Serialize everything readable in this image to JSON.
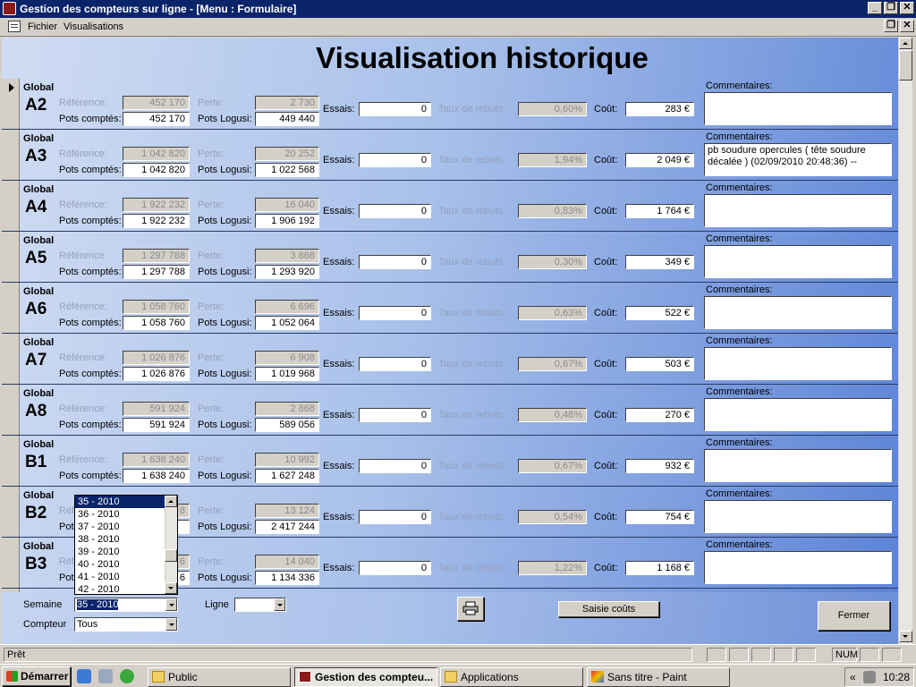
{
  "window": {
    "title": "Gestion des compteurs sur ligne - [Menu : Formulaire]",
    "minimize_glyph": "_",
    "restore_glyph": "❐",
    "close_glyph": "✕"
  },
  "menu": {
    "items": [
      "Fichier",
      "Visualisations"
    ]
  },
  "form": {
    "title": "Visualisation historique",
    "labels": {
      "global": "Global",
      "reference": "Référence:",
      "perte": "Perte:",
      "pots_comptes": "Pots comptés:",
      "pots_logusi": "Pots Logusi:",
      "essais": "Essais:",
      "taux": "Taux de rebuts:",
      "cout": "Coût:",
      "commentaires": "Commentaires:"
    },
    "rows": [
      {
        "code": "A2",
        "reference": "452 170",
        "perte": "2 730",
        "pots_comptes": "452 170",
        "pots_logusi": "449 440",
        "essais": "0",
        "taux": "0,60%",
        "cout": "283 €",
        "commentaire": ""
      },
      {
        "code": "A3",
        "reference": "1 042 820",
        "perte": "20 252",
        "pots_comptes": "1 042 820",
        "pots_logusi": "1 022 568",
        "essais": "0",
        "taux": "1,94%",
        "cout": "2 049 €",
        "commentaire": "pb soudure opercules ( tête soudure décalée ) (02/09/2010 20:48:36) --"
      },
      {
        "code": "A4",
        "reference": "1 922 232",
        "perte": "16 040",
        "pots_comptes": "1 922 232",
        "pots_logusi": "1 906 192",
        "essais": "0",
        "taux": "0,83%",
        "cout": "1 764 €",
        "commentaire": ""
      },
      {
        "code": "A5",
        "reference": "1 297 788",
        "perte": "3 868",
        "pots_comptes": "1 297 788",
        "pots_logusi": "1 293 920",
        "essais": "0",
        "taux": "0,30%",
        "cout": "349 €",
        "commentaire": ""
      },
      {
        "code": "A6",
        "reference": "1 058 760",
        "perte": "6 696",
        "pots_comptes": "1 058 760",
        "pots_logusi": "1 052 064",
        "essais": "0",
        "taux": "0,63%",
        "cout": "522 €",
        "commentaire": ""
      },
      {
        "code": "A7",
        "reference": "1 026 876",
        "perte": "6 908",
        "pots_comptes": "1 026 876",
        "pots_logusi": "1 019 968",
        "essais": "0",
        "taux": "0,67%",
        "cout": "503 €",
        "commentaire": ""
      },
      {
        "code": "A8",
        "reference": "591 924",
        "perte": "2 868",
        "pots_comptes": "591 924",
        "pots_logusi": "589 056",
        "essais": "0",
        "taux": "0,48%",
        "cout": "270 €",
        "commentaire": ""
      },
      {
        "code": "B1",
        "reference": "1 638 240",
        "perte": "10 992",
        "pots_comptes": "1 638 240",
        "pots_logusi": "1 627 248",
        "essais": "0",
        "taux": "0,67%",
        "cout": "932 €",
        "commentaire": ""
      },
      {
        "code": "B2",
        "reference": "8",
        "perte": "13 124",
        "pots_comptes": "",
        "pots_logusi": "2 417 244",
        "essais": "0",
        "taux": "0,54%",
        "cout": "754 €",
        "commentaire": ""
      },
      {
        "code": "B3",
        "reference": "6",
        "perte": "14 040",
        "pots_comptes": "6",
        "pots_logusi": "1 134 336",
        "essais": "0",
        "taux": "1,22%",
        "cout": "1 168 €",
        "commentaire": ""
      }
    ],
    "partial_row_label": "Global"
  },
  "filters": {
    "semaine_label": "Semaine",
    "semaine_value": "35 - 2010",
    "semaine_options": [
      "35 - 2010",
      "36 - 2010",
      "37 - 2010",
      "38 - 2010",
      "39 - 2010",
      "40 - 2010",
      "41 - 2010",
      "42 - 2010"
    ],
    "compteur_label": "Compteur",
    "compteur_value": "Tous",
    "ligne_label": "Ligne",
    "ligne_value": ""
  },
  "buttons": {
    "saisie_couts": "Saisie coûts",
    "fermer": "Fermer",
    "print_icon": "printer-icon"
  },
  "status": {
    "text": "Prêt",
    "num": "NUM"
  },
  "taskbar": {
    "start": "Démarrer",
    "buttons": [
      "Public",
      "Gestion des compteu...",
      "Applications",
      "Sans titre - Paint"
    ],
    "tray_arrows": "«",
    "clock": "10:28"
  }
}
